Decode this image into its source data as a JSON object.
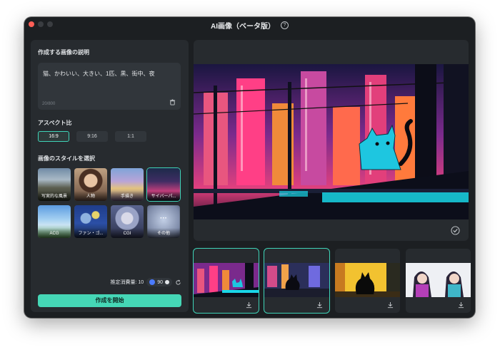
{
  "window": {
    "title": "AI画像（ベータ版）"
  },
  "prompt": {
    "section_label": "作成する画像の説明",
    "text": "猫、かわいい、大きい、1匹、黒、街中、夜",
    "counter": "20/800"
  },
  "aspect": {
    "section_label": "アスペクト比",
    "options": [
      "16:9",
      "9:16",
      "1:1"
    ],
    "selected": "16:9"
  },
  "styles": {
    "section_label": "画像のスタイルを選択",
    "items": [
      {
        "label": "写実的な風景"
      },
      {
        "label": "人物"
      },
      {
        "label": "手描き"
      },
      {
        "label": "サイバーパ..."
      },
      {
        "label": "ACG"
      },
      {
        "label": "ファン・ゴ..."
      },
      {
        "label": "CGI"
      },
      {
        "label": "その他"
      }
    ],
    "selected": "サイバーパ..."
  },
  "cost": {
    "label": "推定消費量: 10",
    "credits": "90"
  },
  "create_button": "作成を開始",
  "colors": {
    "accent": "#45d7b6",
    "selection": "#3fd4b8",
    "panel": "#272b2f",
    "window": "#1c1f22"
  },
  "thumbnails": [
    {
      "name": "cyber-cat-rooftop"
    },
    {
      "name": "cat-street-neon"
    },
    {
      "name": "cat-silhouette-yellow"
    },
    {
      "name": "anime-girls-neon"
    }
  ]
}
